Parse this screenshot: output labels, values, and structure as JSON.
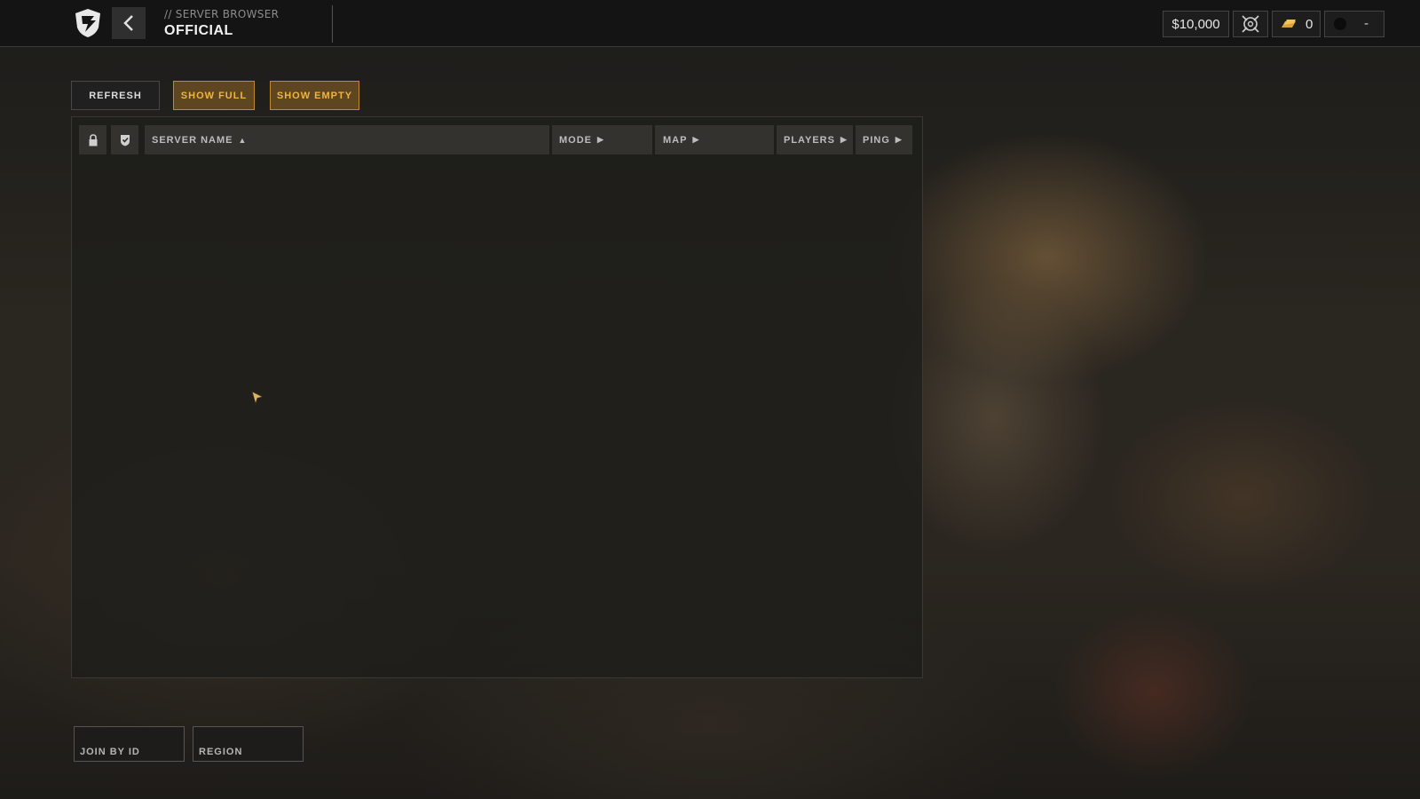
{
  "header": {
    "breadcrumb": "// SERVER BROWSER",
    "title": "OFFICIAL"
  },
  "hud": {
    "money": "$10,000",
    "target_icon": "crosshair-target-icon",
    "gold_icon": "gold-bar-icon",
    "gold_count": "0",
    "profile_value": "-"
  },
  "filters": {
    "refresh_label": "REFRESH",
    "show_full_label": "SHOW FULL",
    "show_empty_label": "SHOW EMPTY"
  },
  "table": {
    "lock_icon": "lock-icon",
    "verified_icon": "shield-check-icon",
    "columns": [
      {
        "label": "SERVER NAME",
        "sort": "▲"
      },
      {
        "label": "MODE",
        "sort": "▶"
      },
      {
        "label": "MAP",
        "sort": "▶"
      },
      {
        "label": "PLAYERS",
        "sort": "▶"
      },
      {
        "label": "PING",
        "sort": "▶"
      }
    ],
    "rows": []
  },
  "bottom": {
    "join_by_id_label": "JOIN BY ID",
    "region_label": "REGION"
  },
  "colors": {
    "accent": "#f0b445",
    "accent_bg": "#5e4620",
    "topbar": "#141414"
  }
}
